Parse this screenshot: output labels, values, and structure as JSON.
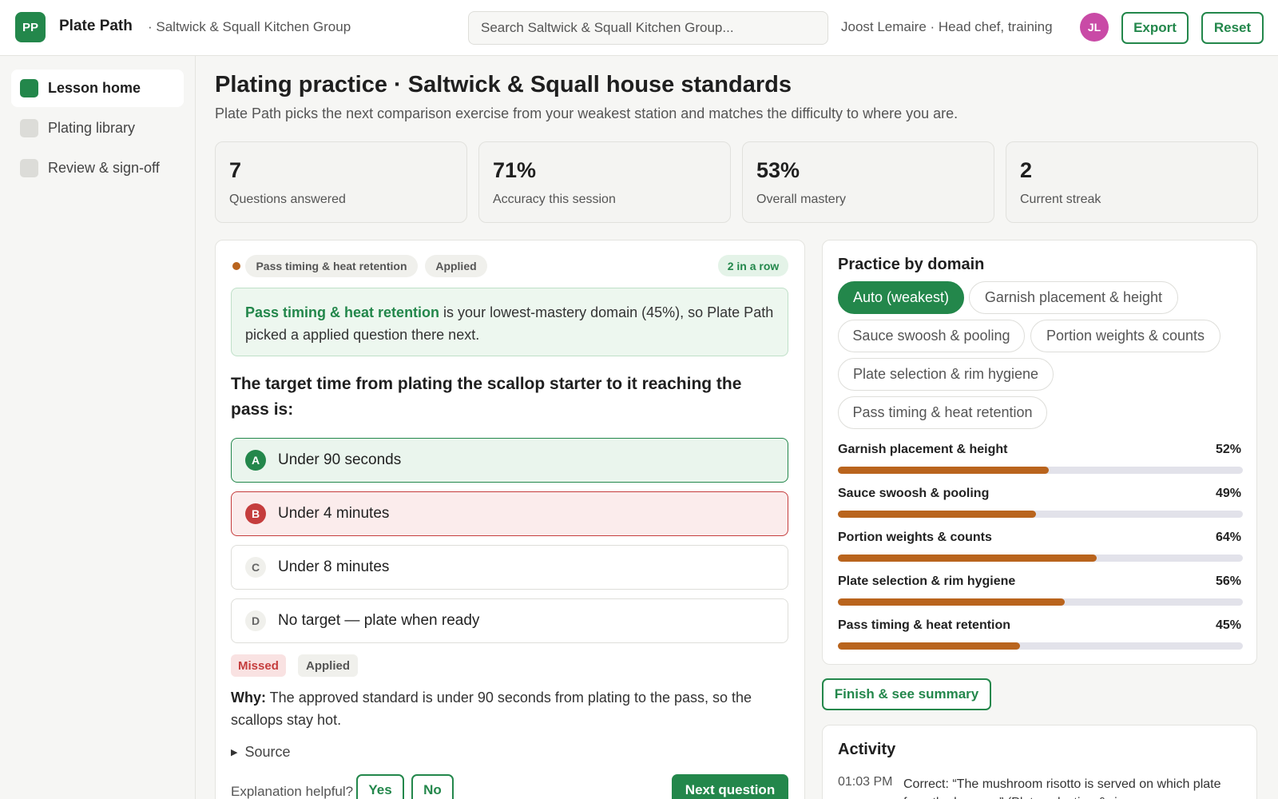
{
  "header": {
    "logo_initials": "PP",
    "app_name": "Plate Path",
    "org_name": "· Saltwick & Squall Kitchen Group",
    "search_placeholder": "Search Saltwick & Squall Kitchen Group...",
    "user_label": "Joost Lemaire · Head chef, training",
    "avatar_initials": "JL",
    "export_label": "Export",
    "reset_label": "Reset"
  },
  "sidebar": {
    "items": [
      {
        "label": "Lesson home",
        "active": true
      },
      {
        "label": "Plating library",
        "active": false
      },
      {
        "label": "Review & sign-off",
        "active": false
      }
    ]
  },
  "page": {
    "title": "Plating practice · Saltwick & Squall house standards",
    "subtitle": "Plate Path picks the next comparison exercise from your weakest station and matches the difficulty to where you are."
  },
  "stats": [
    {
      "value": "7",
      "label": "Questions answered"
    },
    {
      "value": "71%",
      "label": "Accuracy this session"
    },
    {
      "value": "53%",
      "label": "Overall mastery"
    },
    {
      "value": "2",
      "label": "Current streak"
    }
  ],
  "question_card": {
    "domain_tag": "Pass timing & heat retention",
    "type_tag": "Applied",
    "streak": "2 in a row",
    "callout_domain": "Pass timing & heat retention",
    "callout_rest": " is your lowest-mastery domain (45%), so Plate Path picked a applied question there next.",
    "question": "The target time from plating the scallop starter to it reaching the pass is:",
    "options": [
      {
        "letter": "A",
        "text": "Under 90 seconds",
        "state": "correct"
      },
      {
        "letter": "B",
        "text": "Under 4 minutes",
        "state": "wrong"
      },
      {
        "letter": "C",
        "text": "Under 8 minutes",
        "state": "neutral"
      },
      {
        "letter": "D",
        "text": "No target — plate when ready",
        "state": "neutral"
      }
    ],
    "result_tag": "Missed",
    "result_type_tag": "Applied",
    "why_label": "Why:",
    "why_text": " The approved standard is under 90 seconds from plating to the pass, so the scallops stay hot.",
    "source_label": "Source",
    "helpful_label": "Explanation helpful?",
    "yes_label": "Yes",
    "no_label": "No",
    "next_label": "Next question"
  },
  "practice": {
    "title": "Practice by domain",
    "chips": [
      {
        "label": "Auto (weakest)",
        "active": true
      },
      {
        "label": "Garnish placement & height",
        "active": false
      },
      {
        "label": "Sauce swoosh & pooling",
        "active": false
      },
      {
        "label": "Portion weights & counts",
        "active": false
      },
      {
        "label": "Plate selection & rim hygiene",
        "active": false
      },
      {
        "label": "Pass timing & heat retention",
        "active": false
      }
    ],
    "domains": [
      {
        "label": "Garnish placement & height",
        "pct": "52%",
        "value": 52
      },
      {
        "label": "Sauce swoosh & pooling",
        "pct": "49%",
        "value": 49
      },
      {
        "label": "Portion weights & counts",
        "pct": "64%",
        "value": 64
      },
      {
        "label": "Plate selection & rim hygiene",
        "pct": "56%",
        "value": 56
      },
      {
        "label": "Pass timing & heat retention",
        "pct": "45%",
        "value": 45
      }
    ],
    "finish_label": "Finish & see summary"
  },
  "activity": {
    "title": "Activity",
    "entries": [
      {
        "time": "01:03 PM",
        "text": "Correct: “The mushroom risotto is served on which plate from the house...” (Plate selection & rim"
      }
    ]
  },
  "colors": {
    "accent": "#23874b",
    "error": "#c53d3d",
    "progress": "#b9641d",
    "avatar": "#c94aa6"
  }
}
